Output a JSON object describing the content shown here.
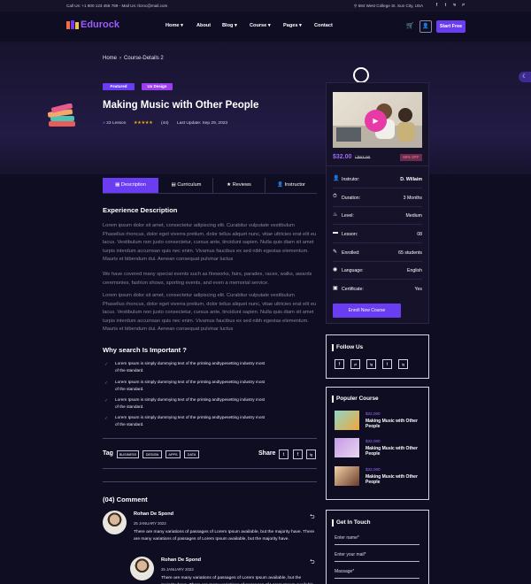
{
  "topbar": {
    "call": "Call Us: +1 800 123 456 789 - Mail Us: Ilcroc@mail.com",
    "address": "684 West College St. Sun City, USA",
    "social": [
      "f",
      "t",
      "ig",
      "yt"
    ]
  },
  "header": {
    "logo": "Edurock",
    "nav": [
      "Home",
      "About",
      "Blog",
      "Course",
      "Pages",
      "Contact"
    ],
    "start_button": "Start Free"
  },
  "breadcrumb": {
    "home": "Home",
    "sep": "›",
    "current": "Course-Details 2"
  },
  "course": {
    "badges": [
      "Featured",
      "Ux Design"
    ],
    "title": "Making Music with Other People",
    "lessons": "23 Lesson",
    "stars": "★★★★★",
    "reviews": "(44)",
    "last_update": "Last Update: Sep 29, 2023"
  },
  "tabs": [
    "Description",
    "Curriculum",
    "Reviews",
    "Instructor"
  ],
  "description": {
    "heading": "Experience Description",
    "para1": "Lorem ipsum dolor sit amet, consectetur adipiscing elit. Curabitur vulputate vestibulum Phasellus rhoncus, dolor eget viverra pretium, dolor tellus aliquet nunc, vitae ultricies erat elit eu lacus. Vestibulum non justo consectetur, cursus ante, tincidunt sapien. Nulla quis diam sit amet turpis interdum accumsan quis nec enim. Vivamus faucibus ex sed nibh egestas elementum. Mauris et bibendum dui. Aenean consequat pulvinar luctus",
    "para2": "We have covered many special events such as fireworks, fairs, parades, races, walks, awards ceremonies, fashion shows, sporting events, and even a memorial service.",
    "para3": "Lorem ipsum dolor sit amet, consectetur adipiscing elit. Curabitur vulputate vestibulum Phasellus rhoncus, dolor eget viverra pretium, dolor tellus aliquet nunc, vitae ultricies erat elit eu lacus. Vestibulum non justo consectetur, cursus ante, tincidunt sapien. Nulla quis diam sit amet turpis interdum accumsan quis nec enim. Vivamus faucibus ex sed nibh egestas elementum. Mauris et bibendum dui. Aenean consequat pulvinar luctus",
    "why_heading": "Why search Is Important ?",
    "bullets": [
      "Lorem Ipsum is simply dummying text of the printing andtypesetting industry most of the standard.",
      "Lorem Ipsum is simply dummying text of the printing andtypesetting industry most of the standard.",
      "Lorem Ipsum is simply dummying text of the printing andtypesetting industry most of the standard.",
      "Lorem Ipsum is simply dummying text of the printing andtypesetting industry most of the standard."
    ]
  },
  "tags": {
    "label": "Tag",
    "items": [
      "BUSINESS",
      "DESIGN",
      "APPS",
      "DATA"
    ],
    "share_label": "Share",
    "share": [
      "t",
      "f",
      "ig"
    ]
  },
  "comments": {
    "heading": "(04) Comment",
    "items": [
      {
        "name": "Rohan De Spond",
        "date": "25 JANUARY 2023",
        "text": "There are many variations of passages of Lorem Ipsum available, but the majority have. There are many variations of passages of Lorem Ipsum available, but the majority have."
      },
      {
        "name": "Rohan De Spond",
        "date": "25 JANUARY 2023",
        "text": "There are many variations of passages of Lorem Ipsum available, but the majority have. There are many variations of passages of Lorem Ipsum available, but the majority have."
      }
    ]
  },
  "card": {
    "price": "$32.00",
    "old_price": "/ $67.00",
    "discount": "68% OFF",
    "rows": [
      {
        "label": "Instrutor:",
        "value": "D. Willaim"
      },
      {
        "label": "Duration:",
        "value": "3 Months"
      },
      {
        "label": "Level:",
        "value": "Medium"
      },
      {
        "label": "Lesson:",
        "value": "08"
      },
      {
        "label": "Enrolled:",
        "value": "65 students"
      },
      {
        "label": "Language:",
        "value": "English"
      },
      {
        "label": "Certificate:",
        "value": "Yes"
      }
    ],
    "enroll": "Enroll Now Course"
  },
  "follow": {
    "title": "Follow Us",
    "items": [
      "f",
      "yt",
      "ig",
      "t",
      "ig"
    ]
  },
  "popular": {
    "title": "Populer Course",
    "items": [
      {
        "price": "$32,000",
        "title": "Making Music with Other People"
      },
      {
        "price": "$32,000",
        "title": "Making Music with Other People"
      },
      {
        "price": "$32,000",
        "title": "Making Music with Other People"
      }
    ]
  },
  "touch": {
    "title": "Get In Touch",
    "fields": [
      "Enter name*",
      "Enter your mail*",
      "Massage*"
    ]
  },
  "colors": {
    "accent": "#6a3cf2",
    "pink": "#e83aa6",
    "background": "#0f0d22"
  }
}
